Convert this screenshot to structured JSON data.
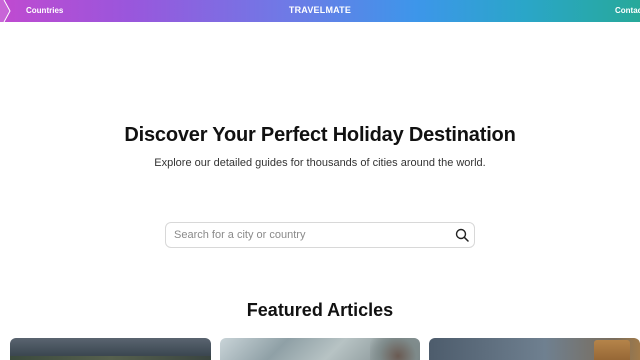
{
  "nav": {
    "countries": "Countries",
    "brand": "TRAVELMATE",
    "contact": "Contact"
  },
  "hero": {
    "title": "Discover Your Perfect Holiday Destination",
    "subtitle": "Explore our detailed guides for thousands of cities around the world."
  },
  "search": {
    "placeholder": "Search for a city or country",
    "value": ""
  },
  "featured": {
    "title": "Featured Articles",
    "cards": [
      {
        "image": "landscape-photo"
      },
      {
        "image": "tree-photo"
      },
      {
        "image": "city-tower-photo"
      }
    ]
  },
  "colors": {
    "nav_gradient_start": "#c04ad0",
    "nav_gradient_end": "#27a99a"
  }
}
